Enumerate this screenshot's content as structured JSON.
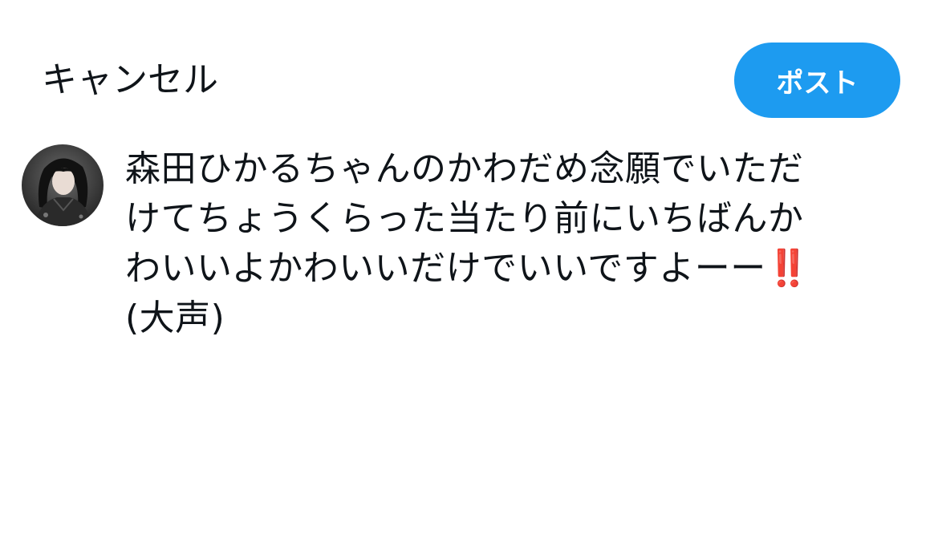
{
  "header": {
    "cancel_label": "キャンセル",
    "post_label": "ポスト"
  },
  "composer": {
    "lines": [
      "森田ひかるちゃんのかわだめ念願でいただ",
      "けてちょうくらった当たり前にいちばんか",
      "わいいよかわいいだけでいいですよーー",
      "(大声)"
    ],
    "emoji": "‼️"
  },
  "colors": {
    "accent": "#1d9bf0",
    "text": "#0f1419",
    "emoji": "#e0245e"
  }
}
